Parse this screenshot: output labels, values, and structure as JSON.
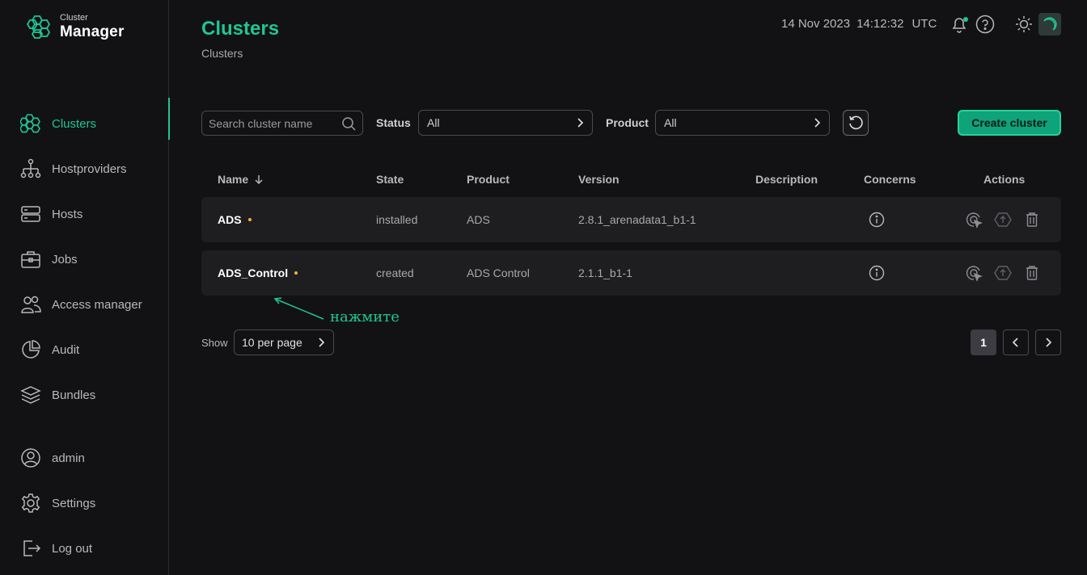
{
  "app": {
    "logo_small": "Cluster",
    "logo_big": "Manager"
  },
  "sidebar": {
    "items": [
      {
        "label": "Clusters",
        "icon": "clusters-icon",
        "active": true
      },
      {
        "label": "Hostproviders",
        "icon": "hostproviders-icon"
      },
      {
        "label": "Hosts",
        "icon": "hosts-icon"
      },
      {
        "label": "Jobs",
        "icon": "jobs-icon"
      },
      {
        "label": "Access manager",
        "icon": "access-manager-icon"
      },
      {
        "label": "Audit",
        "icon": "audit-icon"
      },
      {
        "label": "Bundles",
        "icon": "bundles-icon"
      }
    ],
    "bottom": [
      {
        "label": "admin",
        "icon": "user-icon"
      },
      {
        "label": "Settings",
        "icon": "gear-icon"
      },
      {
        "label": "Log out",
        "icon": "logout-icon"
      }
    ]
  },
  "header": {
    "title": "Clusters",
    "breadcrumb": "Clusters",
    "date": "14 Nov 2023",
    "time": "14:12:32",
    "timezone": "UTC",
    "icons": [
      "bell-icon",
      "help-icon",
      "sun-icon",
      "moon-icon"
    ]
  },
  "toolbar": {
    "search_placeholder": "Search cluster name",
    "status_label": "Status",
    "status_value": "All",
    "product_label": "Product",
    "product_value": "All",
    "create_label": "Create cluster"
  },
  "table": {
    "columns": [
      "Name",
      "State",
      "Product",
      "Version",
      "Description",
      "Concerns",
      "Actions"
    ],
    "rows": [
      {
        "name": "ADS",
        "state": "installed",
        "product": "ADS",
        "version": "2.8.1_arenadata1_b1-1",
        "description": ""
      },
      {
        "name": "ADS_Control",
        "state": "created",
        "product": "ADS Control",
        "version": "2.1.1_b1-1",
        "description": ""
      }
    ]
  },
  "annotation": {
    "text": "нажмите"
  },
  "pagination": {
    "show_label": "Show",
    "per_page": "10 per page",
    "current_page": "1"
  },
  "colors": {
    "accent": "#21c592",
    "background": "#121214",
    "row_bg": "#1e1e21",
    "concern_dot": "#f5b335"
  }
}
